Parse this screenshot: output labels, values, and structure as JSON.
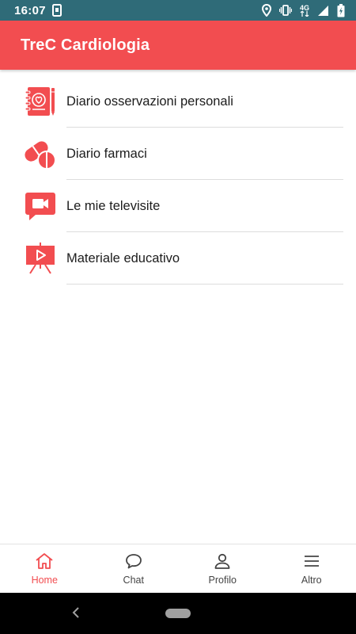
{
  "status_bar": {
    "time": "16:07",
    "network": "4G",
    "icons": [
      "notification-icon",
      "location-icon",
      "vibrate-icon",
      "signal-icon",
      "battery-charging-icon"
    ]
  },
  "app_bar": {
    "title": "TreC Cardiologia",
    "color": "#f24d50"
  },
  "menu": {
    "items": [
      {
        "label": "Diario osservazioni personali",
        "icon": "diary-heart-icon"
      },
      {
        "label": "Diario farmaci",
        "icon": "pills-icon"
      },
      {
        "label": "Le mie televisite",
        "icon": "video-chat-icon"
      },
      {
        "label": "Materiale educativo",
        "icon": "presentation-icon"
      }
    ]
  },
  "bottom_nav": {
    "items": [
      {
        "label": "Home",
        "icon": "home-icon",
        "active": true
      },
      {
        "label": "Chat",
        "icon": "chat-bubble-icon",
        "active": false
      },
      {
        "label": "Profilo",
        "icon": "person-icon",
        "active": false
      },
      {
        "label": "Altro",
        "icon": "hamburger-menu-icon",
        "active": false
      }
    ]
  },
  "colors": {
    "accent": "#f24d50",
    "status_bar": "#2f6b78",
    "text": "#1c1c1c"
  }
}
